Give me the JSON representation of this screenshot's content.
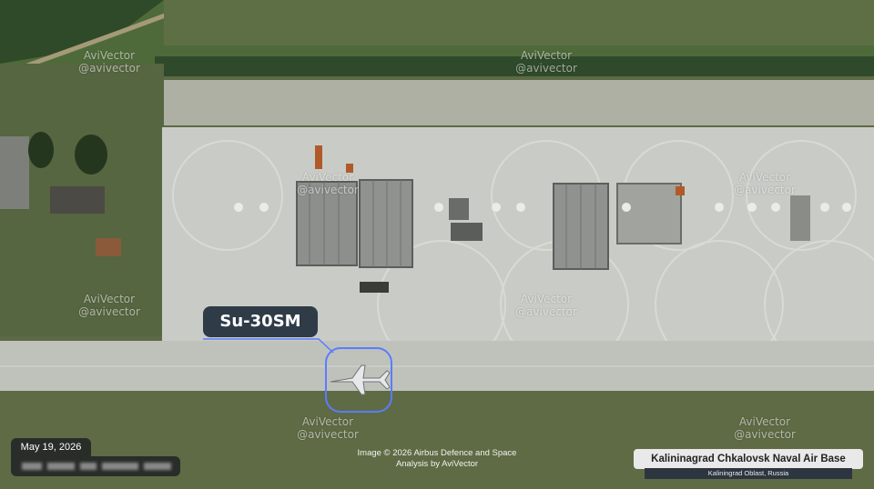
{
  "aircraft_label": "Su-30SM",
  "date": "May 19, 2026",
  "credit": {
    "line1": "Image © 2026 Airbus Defence and Space",
    "line2": "Analysis by AviVector"
  },
  "location": {
    "title": "Kalininagrad Chkalovsk Naval Air Base",
    "subtitle": "Kaliningrad Oblast, Russia"
  },
  "watermark": {
    "name": "AviVector",
    "handle": "@avivector"
  },
  "colors": {
    "highlight_circle": "#5b7cff",
    "callout_bg": "#2f3b47",
    "apron": "#c9ccc6",
    "grass": "#5f6a4a"
  }
}
